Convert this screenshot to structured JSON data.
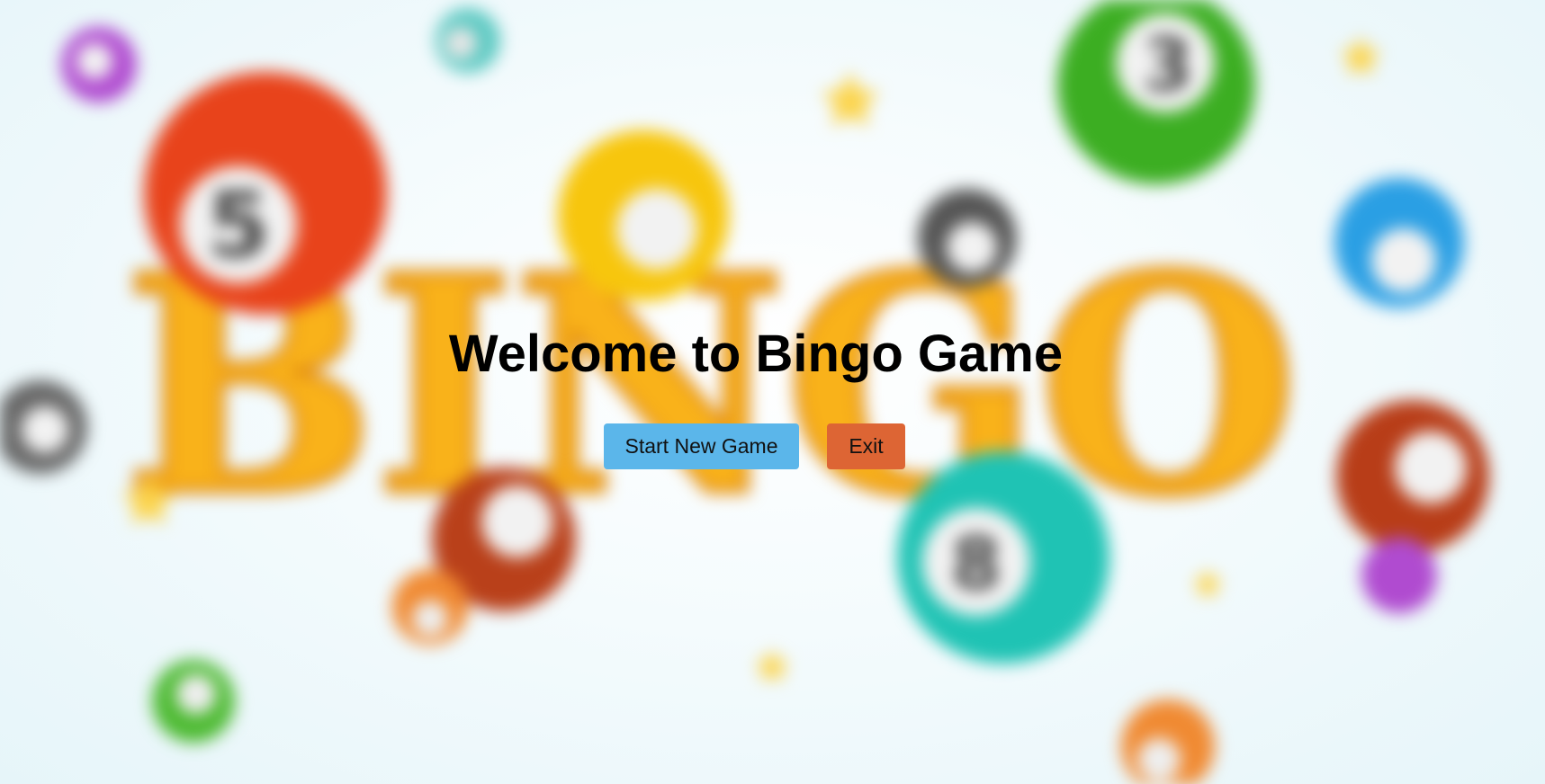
{
  "page": {
    "title": "Welcome to Bingo Game"
  },
  "buttons": {
    "start_label": "Start New Game",
    "exit_label": "Exit"
  },
  "background": {
    "word": "BINGO",
    "ball_numbers": [
      "5",
      "3",
      "8"
    ]
  },
  "colors": {
    "start_button": "#5bb6ea",
    "exit_button": "#dd6534",
    "word_fill": "#f9b21a",
    "title_text": "#000000"
  },
  "icons": {
    "background": "bingo-balls-illustration"
  }
}
